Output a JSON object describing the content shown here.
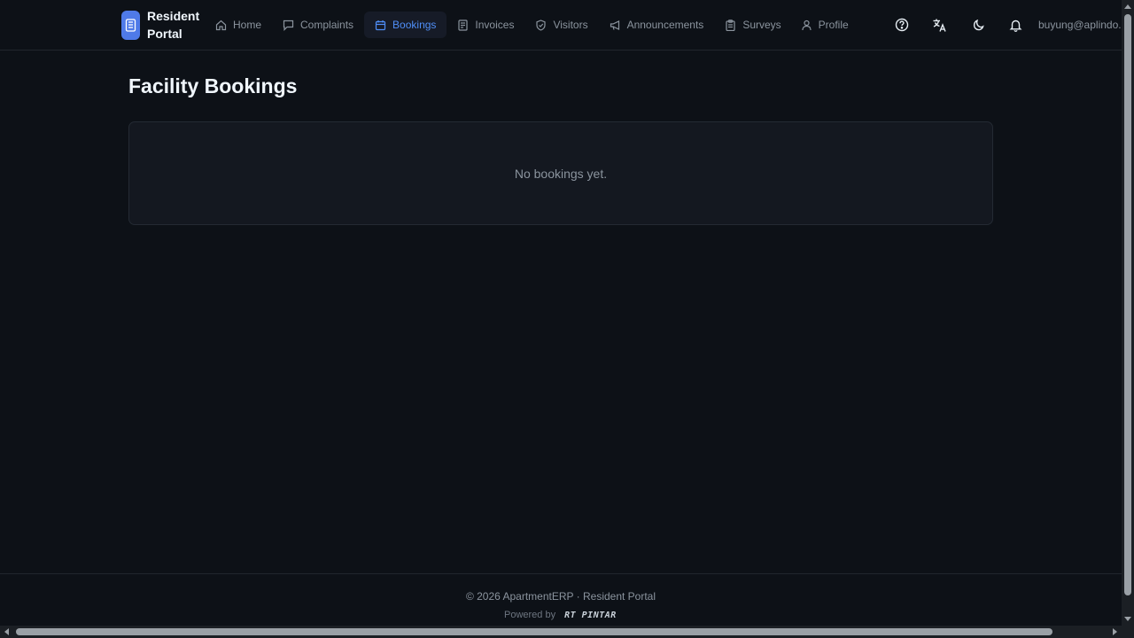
{
  "brand": {
    "name": "Resident Portal"
  },
  "nav": {
    "items": [
      {
        "id": "home",
        "label": "Home",
        "icon": "home-icon"
      },
      {
        "id": "complaints",
        "label": "Complaints",
        "icon": "chat-bubble-icon"
      },
      {
        "id": "bookings",
        "label": "Bookings",
        "icon": "calendar-icon",
        "active": true
      },
      {
        "id": "invoices",
        "label": "Invoices",
        "icon": "document-icon"
      },
      {
        "id": "visitors",
        "label": "Visitors",
        "icon": "shield-icon"
      },
      {
        "id": "announcements",
        "label": "Announcements",
        "icon": "megaphone-icon"
      },
      {
        "id": "surveys",
        "label": "Surveys",
        "icon": "clipboard-icon"
      },
      {
        "id": "profile",
        "label": "Profile",
        "icon": "user-icon"
      }
    ]
  },
  "header_actions": [
    "help-icon",
    "translate-icon",
    "moon-icon",
    "bell-icon"
  ],
  "user": {
    "email": "buyung@aplindo."
  },
  "main": {
    "title": "Facility Bookings",
    "empty_message": "No bookings yet."
  },
  "footer": {
    "copyright": "© 2026 ApartmentERP · Resident Portal",
    "powered_by": "Powered by",
    "powered_logo": "RT PINTAR"
  },
  "colors": {
    "background": "#0d1117",
    "accent": "#4f8ef7",
    "brand_logo": "#4f7ae8",
    "card": "#141820"
  }
}
